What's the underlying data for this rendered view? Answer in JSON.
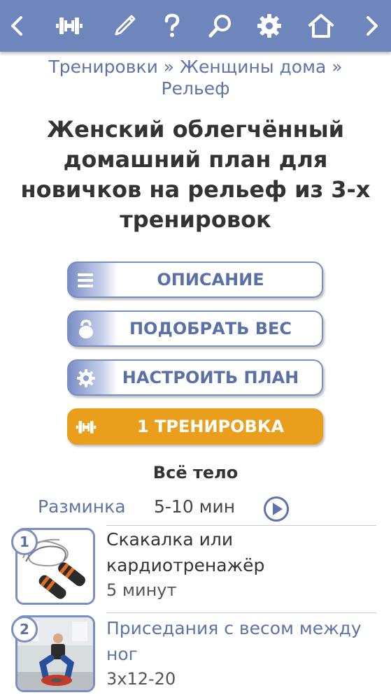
{
  "toolbar": {
    "items": [
      {
        "icon": "chevron-left-icon"
      },
      {
        "icon": "dumbbell-icon"
      },
      {
        "icon": "pen-icon"
      },
      {
        "icon": "help-icon"
      },
      {
        "icon": "search-icon"
      },
      {
        "icon": "gear-icon"
      },
      {
        "icon": "home-icon"
      },
      {
        "icon": "chevron-right-icon"
      }
    ],
    "color": "#6f86bd"
  },
  "breadcrumb": {
    "part1": "Тренировки",
    "sep1": " » ",
    "part2": "Женщины дома",
    "sep2": " »",
    "part3": "Рельеф"
  },
  "title": "Женский облегчённый домашний план для новичков на рельеф из 3-х тренировок",
  "buttons": {
    "description": "ОПИСАНИЕ",
    "pick_weight": "ПОДОБРАТЬ ВЕС",
    "configure_plan": "НАСТРОИТЬ ПЛАН",
    "workout": "1 ТРЕНИРОВКА"
  },
  "colors": {
    "accent": "#5d74a8",
    "orange": "#e99e1c"
  },
  "section": {
    "title": "Всё тело",
    "warmup_label": "Разминка",
    "warmup_time": "5-10 мин"
  },
  "exercises": [
    {
      "num": "1",
      "name_line1": "Скакалка или",
      "name_line2": "кардиотренажёр",
      "detail": "5 минут"
    },
    {
      "num": "2",
      "name_line1": "Приседания с весом между",
      "name_line2": "ног",
      "detail": "3x12-20"
    }
  ]
}
